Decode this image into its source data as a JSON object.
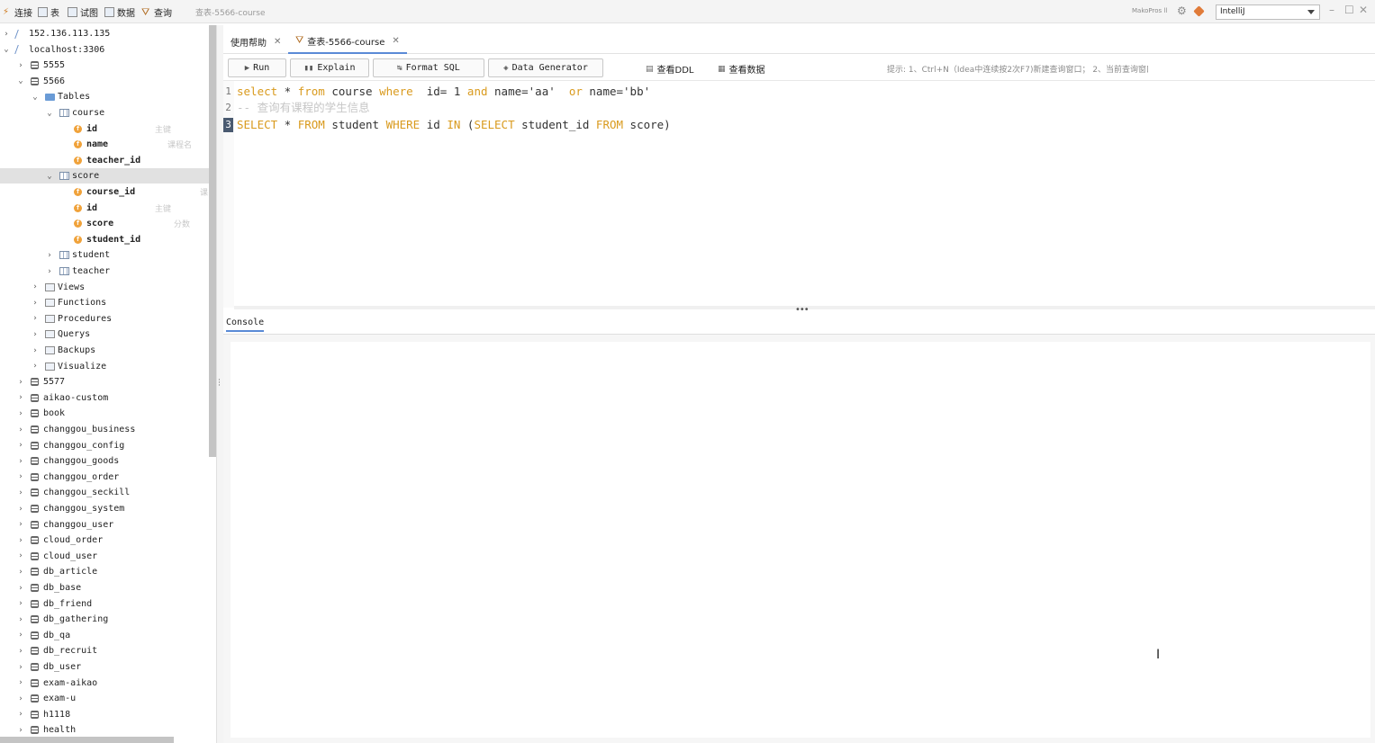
{
  "menubar": {
    "items": [
      {
        "label": "连接",
        "icon": "plug-icon"
      },
      {
        "label": "表",
        "icon": "table-icon"
      },
      {
        "label": "试图",
        "icon": "view-icon"
      },
      {
        "label": "数据",
        "icon": "data-icon"
      },
      {
        "label": "查询",
        "icon": "query-icon"
      }
    ],
    "window_title": "查表-5566-course",
    "user": "MakoPros ll",
    "theme": "IntelliJ"
  },
  "tree": {
    "rows": [
      {
        "label": "152.136.113.135",
        "depth": 0,
        "chevron": "›",
        "icon": "server"
      },
      {
        "label": "localhost:3306",
        "depth": 0,
        "chevron": "⌄",
        "icon": "server"
      },
      {
        "label": "5555",
        "depth": 1,
        "chevron": "›",
        "icon": "db"
      },
      {
        "label": "5566",
        "depth": 1,
        "chevron": "⌄",
        "icon": "db"
      },
      {
        "label": "Tables",
        "depth": 2,
        "chevron": "⌄",
        "icon": "folder"
      },
      {
        "label": "course",
        "depth": 3,
        "chevron": "⌄",
        "icon": "table"
      },
      {
        "label": "id",
        "depth": 4,
        "chevron": "",
        "icon": "field",
        "comment": "主键"
      },
      {
        "label": "name",
        "depth": 4,
        "chevron": "",
        "icon": "field",
        "comment": "课程名"
      },
      {
        "label": "teacher_id",
        "depth": 4,
        "chevron": "",
        "icon": "field",
        "comment": ""
      },
      {
        "label": "score",
        "depth": 3,
        "chevron": "⌄",
        "icon": "table",
        "selected": true
      },
      {
        "label": "course_id",
        "depth": 4,
        "chevron": "",
        "icon": "field",
        "comment": "课"
      },
      {
        "label": "id",
        "depth": 4,
        "chevron": "",
        "icon": "field",
        "comment": "主键"
      },
      {
        "label": "score",
        "depth": 4,
        "chevron": "",
        "icon": "field",
        "comment": "分数"
      },
      {
        "label": "student_id",
        "depth": 4,
        "chevron": "",
        "icon": "field",
        "comment": ""
      },
      {
        "label": "student",
        "depth": 3,
        "chevron": "›",
        "icon": "table"
      },
      {
        "label": "teacher",
        "depth": 3,
        "chevron": "›",
        "icon": "table"
      },
      {
        "label": "Views",
        "depth": 2,
        "chevron": "›",
        "icon": "misc"
      },
      {
        "label": "Functions",
        "depth": 2,
        "chevron": "›",
        "icon": "misc"
      },
      {
        "label": "Procedures",
        "depth": 2,
        "chevron": "›",
        "icon": "misc"
      },
      {
        "label": "Querys",
        "depth": 2,
        "chevron": "›",
        "icon": "misc"
      },
      {
        "label": "Backups",
        "depth": 2,
        "chevron": "›",
        "icon": "misc"
      },
      {
        "label": "Visualize",
        "depth": 2,
        "chevron": "›",
        "icon": "misc"
      },
      {
        "label": "5577",
        "depth": 1,
        "chevron": "›",
        "icon": "db"
      },
      {
        "label": "aikao-custom",
        "depth": 1,
        "chevron": "›",
        "icon": "db"
      },
      {
        "label": "book",
        "depth": 1,
        "chevron": "›",
        "icon": "db"
      },
      {
        "label": "changgou_business",
        "depth": 1,
        "chevron": "›",
        "icon": "db"
      },
      {
        "label": "changgou_config",
        "depth": 1,
        "chevron": "›",
        "icon": "db"
      },
      {
        "label": "changgou_goods",
        "depth": 1,
        "chevron": "›",
        "icon": "db"
      },
      {
        "label": "changgou_order",
        "depth": 1,
        "chevron": "›",
        "icon": "db"
      },
      {
        "label": "changgou_seckill",
        "depth": 1,
        "chevron": "›",
        "icon": "db"
      },
      {
        "label": "changgou_system",
        "depth": 1,
        "chevron": "›",
        "icon": "db"
      },
      {
        "label": "changgou_user",
        "depth": 1,
        "chevron": "›",
        "icon": "db"
      },
      {
        "label": "cloud_order",
        "depth": 1,
        "chevron": "›",
        "icon": "db"
      },
      {
        "label": "cloud_user",
        "depth": 1,
        "chevron": "›",
        "icon": "db"
      },
      {
        "label": "db_article",
        "depth": 1,
        "chevron": "›",
        "icon": "db"
      },
      {
        "label": "db_base",
        "depth": 1,
        "chevron": "›",
        "icon": "db"
      },
      {
        "label": "db_friend",
        "depth": 1,
        "chevron": "›",
        "icon": "db"
      },
      {
        "label": "db_gathering",
        "depth": 1,
        "chevron": "›",
        "icon": "db"
      },
      {
        "label": "db_qa",
        "depth": 1,
        "chevron": "›",
        "icon": "db"
      },
      {
        "label": "db_recruit",
        "depth": 1,
        "chevron": "›",
        "icon": "db"
      },
      {
        "label": "db_user",
        "depth": 1,
        "chevron": "›",
        "icon": "db"
      },
      {
        "label": "exam-aikao",
        "depth": 1,
        "chevron": "›",
        "icon": "db"
      },
      {
        "label": "exam-u",
        "depth": 1,
        "chevron": "›",
        "icon": "db"
      },
      {
        "label": "h1118",
        "depth": 1,
        "chevron": "›",
        "icon": "db"
      },
      {
        "label": "health",
        "depth": 1,
        "chevron": "›",
        "icon": "db"
      }
    ]
  },
  "tabs": [
    {
      "label": "使用帮助",
      "active": false,
      "icon": ""
    },
    {
      "label": "查表-5566-course",
      "active": true,
      "icon": "query-icon"
    }
  ],
  "toolbar": {
    "run_label": "Run",
    "explain_label": "Explain",
    "format_label": "Format SQL",
    "generator_label": "Data Generator",
    "ddl_label": "查看DDL",
    "data_label": "查看数据",
    "hint": "提示: 1、Ctrl+N（Idea中连续按2次F7)新建查询窗口； 2、当前查询窗口可查询当前数据库中所有表"
  },
  "editor": {
    "line_numbers": [
      "1",
      "2",
      "3"
    ],
    "current_line": 3,
    "lines": [
      [
        {
          "t": "select",
          "k": "kw"
        },
        {
          "t": " * ",
          "k": ""
        },
        {
          "t": "from",
          "k": "kw"
        },
        {
          "t": " course ",
          "k": ""
        },
        {
          "t": "where",
          "k": "kw"
        },
        {
          "t": "  id= 1 ",
          "k": ""
        },
        {
          "t": "and",
          "k": "kw"
        },
        {
          "t": " name='aa'  ",
          "k": ""
        },
        {
          "t": "or",
          "k": "kw"
        },
        {
          "t": " name='bb'",
          "k": ""
        }
      ],
      [
        {
          "t": "-- 查询有课程的学生信息",
          "k": "cm"
        }
      ],
      [
        {
          "t": "SELECT",
          "k": "kw"
        },
        {
          "t": " * ",
          "k": ""
        },
        {
          "t": "FROM",
          "k": "kw"
        },
        {
          "t": " student ",
          "k": ""
        },
        {
          "t": "WHERE",
          "k": "kw"
        },
        {
          "t": " id ",
          "k": ""
        },
        {
          "t": "IN",
          "k": "kw"
        },
        {
          "t": " (",
          "k": ""
        },
        {
          "t": "SELECT",
          "k": "kw"
        },
        {
          "t": " student_id ",
          "k": ""
        },
        {
          "t": "FROM",
          "k": "kw"
        },
        {
          "t": " score)",
          "k": ""
        }
      ]
    ]
  },
  "console": {
    "tab_label": "Console"
  },
  "colors": {
    "keyword": "#d99a1d",
    "comment": "#c6c6c6",
    "accent": "#5a8ad6"
  }
}
